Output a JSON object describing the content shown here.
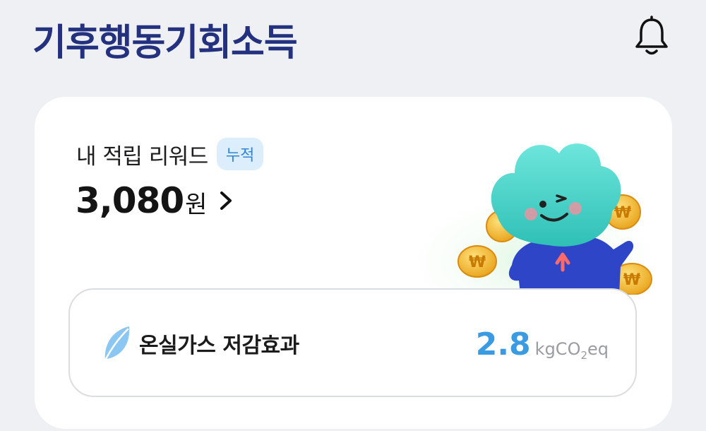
{
  "header": {
    "logo_text": "기후행동기회소득",
    "icons": {
      "notification": "bell-icon"
    }
  },
  "reward": {
    "title": "내 적립 리워드",
    "badge": "누적",
    "amount": "3,080",
    "unit": "원"
  },
  "effect": {
    "label": "온실가스 저감효과",
    "value": "2.8",
    "unit_prefix": "kgCO",
    "unit_sub": "2",
    "unit_suffix": "eq",
    "icon": "leaf-icon"
  },
  "colors": {
    "background": "#eef0f4",
    "logo": "#23317f",
    "accent_blue": "#3a9be3",
    "badge_bg": "#dcedfb",
    "mascot": "#3fd1c8"
  }
}
